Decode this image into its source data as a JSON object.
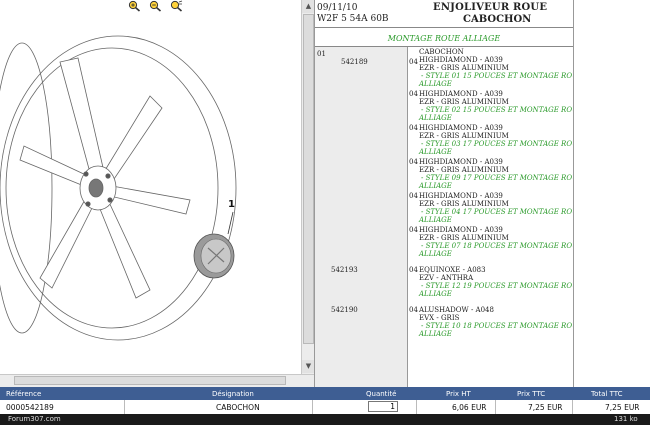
{
  "header": {
    "date": "09/11/10",
    "code": "W2F 5 54A 60B",
    "title_line1": "ENJOLIVEUR ROUE",
    "title_line2": "CABOCHON",
    "subtitle": "MONTAGE ROUE ALLIAGE"
  },
  "diagram": {
    "callout": "1"
  },
  "zoom": {
    "zoom_in": "zoom-in-icon",
    "zoom_out": "zoom-out-icon",
    "zoom_reset": "zoom-reset-icon"
  },
  "parts_list": {
    "index": "01",
    "groups": [
      {
        "ref": "542189",
        "entries": [
          {
            "qty": "04",
            "lines": [
              "CABOCHON",
              "HIGHDIAMOND - A039",
              "EZR - GRIS ALUMINIUM"
            ],
            "note": [
              "- STYLE 01 15 POUCES ET MONTAGE ROUE",
              "ALLIAGE"
            ]
          },
          {
            "qty": "04",
            "lines": [
              "HIGHDIAMOND - A039",
              "EZR - GRIS ALUMINIUM"
            ],
            "note": [
              "- STYLE 02 15 POUCES ET MONTAGE ROUE",
              "ALLIAGE"
            ]
          },
          {
            "qty": "04",
            "lines": [
              "HIGHDIAMOND - A039",
              "EZR - GRIS ALUMINIUM"
            ],
            "note": [
              "- STYLE 03 17 POUCES ET MONTAGE ROUE",
              "ALLIAGE"
            ]
          },
          {
            "qty": "04",
            "lines": [
              "HIGHDIAMOND - A039",
              "EZR - GRIS ALUMINIUM"
            ],
            "note": [
              "- STYLE 09 17 POUCES ET MONTAGE ROUE",
              "ALLIAGE"
            ]
          },
          {
            "qty": "04",
            "lines": [
              "HIGHDIAMOND - A039",
              "EZR - GRIS ALUMINIUM"
            ],
            "note": [
              "- STYLE 04 17 POUCES ET MONTAGE ROUE",
              "ALLIAGE"
            ]
          },
          {
            "qty": "04",
            "lines": [
              "HIGHDIAMOND - A039",
              "EZR - GRIS ALUMINIUM"
            ],
            "note": [
              "- STYLE 07 18 POUCES ET MONTAGE ROUE",
              "ALLIAGE"
            ]
          }
        ]
      },
      {
        "ref": "542193",
        "entries": [
          {
            "qty": "04",
            "lines": [
              "EQUINOXE - A083",
              "EZV - ANTHRA"
            ],
            "note": [
              "- STYLE 12 19 POUCES ET MONTAGE ROUE",
              "ALLIAGE"
            ]
          }
        ]
      },
      {
        "ref": "542190",
        "entries": [
          {
            "qty": "04",
            "lines": [
              "ALUSHADOW - A048",
              "EVX - GRIS"
            ],
            "note": [
              "- STYLE 10 18 POUCES ET MONTAGE ROUE",
              "ALLIAGE"
            ]
          }
        ]
      }
    ]
  },
  "grid": {
    "headers": [
      "Référence",
      "Désignation",
      "Quantité",
      "Prix HT",
      "Prix TTC",
      "Total TTC"
    ],
    "row": {
      "reference": "0000542189",
      "designation": "CABOCHON",
      "quantity": "1",
      "prix_ht": "6,06 EUR",
      "prix_ttc": "7,25 EUR",
      "total_ttc": "7,25 EUR"
    }
  },
  "footer": {
    "watermark": "Forum307.com",
    "size": "131 ko"
  },
  "colors": {
    "header_bg": "#3e5e93",
    "note_green": "#2a9a2a"
  }
}
